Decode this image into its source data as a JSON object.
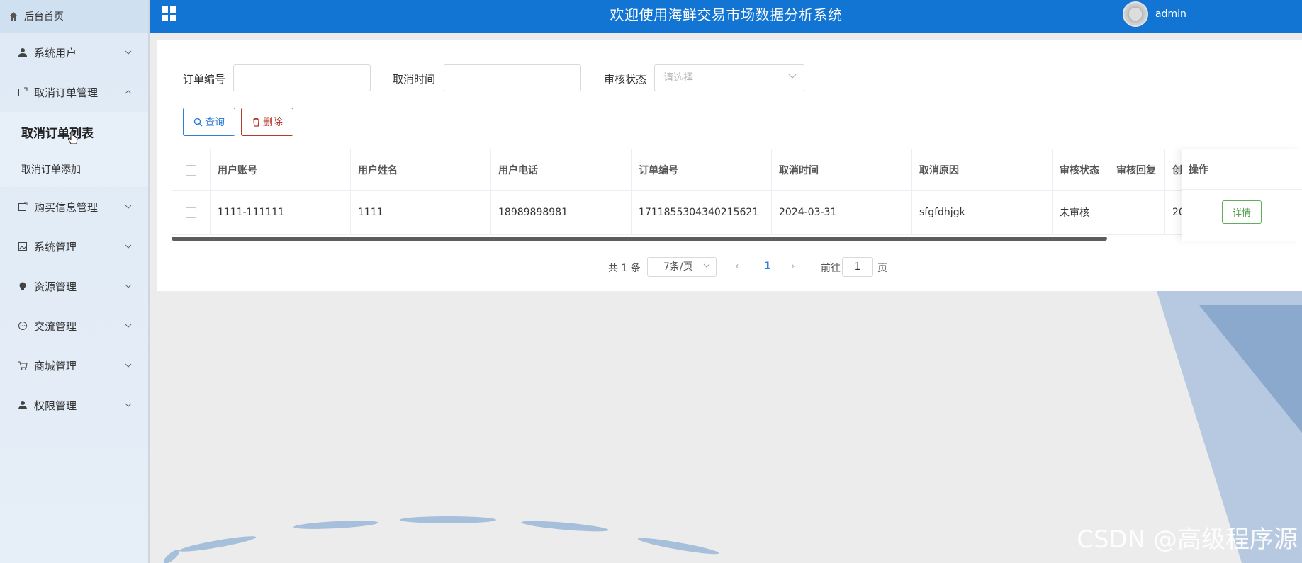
{
  "sidebar": {
    "home_label": "后台首页",
    "items": [
      {
        "label": "系统用户",
        "icon": "user-icon"
      },
      {
        "label": "取消订单管理",
        "icon": "doc-icon",
        "expanded": true,
        "children": [
          {
            "label": "取消订单列表",
            "active": true
          },
          {
            "label": "取消订单添加"
          }
        ]
      },
      {
        "label": "购买信息管理",
        "icon": "doc-icon"
      },
      {
        "label": "系统管理",
        "icon": "image-icon"
      },
      {
        "label": "资源管理",
        "icon": "bulb-icon"
      },
      {
        "label": "交流管理",
        "icon": "chat-icon"
      },
      {
        "label": "商城管理",
        "icon": "cart-icon"
      },
      {
        "label": "权限管理",
        "icon": "user-icon"
      }
    ]
  },
  "header": {
    "title": "欢迎使用海鲜交易市场数据分析系统",
    "username": "admin"
  },
  "search": {
    "order_no_label": "订单编号",
    "cancel_time_label": "取消时间",
    "audit_status_label": "审核状态",
    "audit_status_placeholder": "请选择",
    "query_label": "查询",
    "delete_label": "删除"
  },
  "table": {
    "columns": [
      "用户账号",
      "用户姓名",
      "用户电话",
      "订单编号",
      "取消时间",
      "取消原因",
      "审核状态",
      "审核回复",
      "创",
      "操作"
    ],
    "rows": [
      {
        "account": "1111-111111",
        "name": "1111",
        "phone": "18989898981",
        "order_no": "1711855304340215621",
        "cancel_time": "2024-03-31",
        "reason": "sfgfdhjgk",
        "status": "未审核",
        "reply": "",
        "created": "20",
        "action": "详情"
      }
    ]
  },
  "pagination": {
    "total": "共 1 条",
    "page_size": "7条/页",
    "current_page": "1",
    "goto_label": "前往",
    "goto_value": "1",
    "page_suffix": "页"
  },
  "watermark": "CSDN @高级程序源",
  "colors": {
    "header": "#1275d3",
    "primary": "#2f7ed8",
    "danger": "#b53a2b",
    "success": "#4a9a44"
  }
}
